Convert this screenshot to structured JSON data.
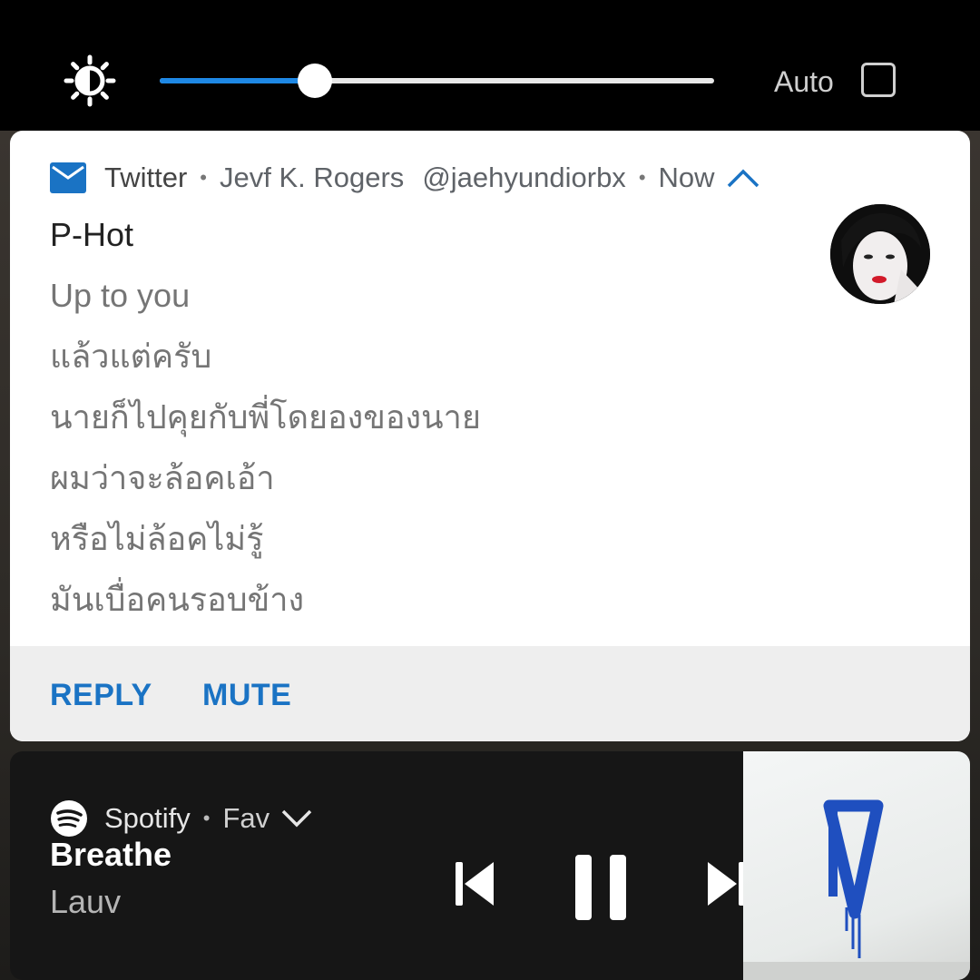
{
  "quick_settings": {
    "brightness_level": 0.28,
    "auto_label": "Auto",
    "auto_checked": false
  },
  "notification": {
    "app_name": "Twitter",
    "sender": "Jevf K. Rogers",
    "handle": "@jaehyundiorbx",
    "time": "Now",
    "title": "P-Hot",
    "lines": [
      "Up to you",
      "แล้วแต่ครับ",
      "นายก็ไปคุยกับพี่โดยองของนาย",
      "ผมว่าจะล้อคเอ้า",
      "หรือไม่ล้อคไม่รู้",
      "มันเบื่อคนรอบข้าง"
    ],
    "actions": {
      "reply": "REPLY",
      "mute": "MUTE"
    }
  },
  "media": {
    "app_name": "Spotify",
    "context": "Fav",
    "track": "Breathe",
    "artist": "Lauv"
  },
  "colors": {
    "accent_blue": "#1e88e5",
    "action_blue": "#1a73c4",
    "album_mark_blue": "#1f4fbf"
  }
}
